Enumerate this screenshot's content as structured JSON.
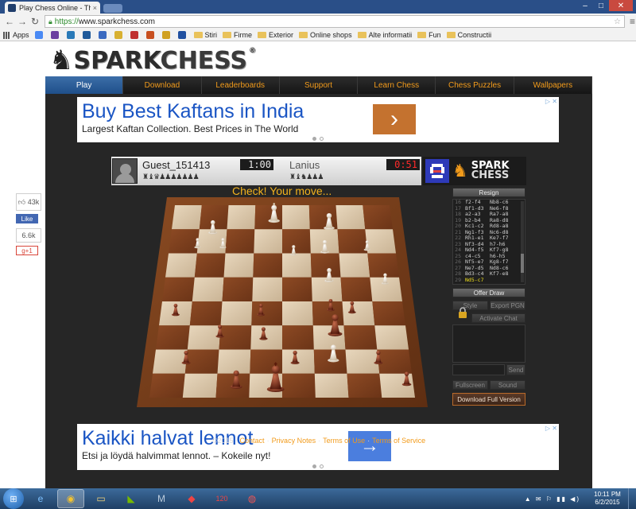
{
  "browser": {
    "tab_title": "Play Chess Online - The P",
    "tab_close": "×",
    "url_scheme": "https://",
    "url_host": "www.sparkchess.com",
    "back_icon": "←",
    "forward_icon": "→",
    "reload_icon": "↻",
    "window_min": "–",
    "window_max": "□",
    "window_close": "✕",
    "bookmarks": [
      {
        "label": "Apps",
        "type": "apps"
      },
      {
        "label": "",
        "type": "icon",
        "color": "#4a8af4"
      },
      {
        "label": "",
        "type": "icon",
        "color": "#6b3fa0"
      },
      {
        "label": "",
        "type": "icon",
        "color": "#2a7ab8"
      },
      {
        "label": "",
        "type": "icon",
        "color": "#1f5a9a"
      },
      {
        "label": "",
        "type": "icon",
        "color": "#3a6ac0"
      },
      {
        "label": "",
        "type": "icon",
        "color": "#d8b030"
      },
      {
        "label": "",
        "type": "icon",
        "color": "#c03030"
      },
      {
        "label": "",
        "type": "icon",
        "color": "#c85020"
      },
      {
        "label": "",
        "type": "icon",
        "color": "#d0a020"
      },
      {
        "label": "",
        "type": "icon",
        "color": "#2050a0"
      },
      {
        "label": "Stiri",
        "type": "folder"
      },
      {
        "label": "Firme",
        "type": "folder"
      },
      {
        "label": "Exterior",
        "type": "folder"
      },
      {
        "label": "Online shops",
        "type": "folder"
      },
      {
        "label": "Alte informatii",
        "type": "folder"
      },
      {
        "label": "Fun",
        "type": "folder"
      },
      {
        "label": "Constructii",
        "type": "folder"
      }
    ]
  },
  "site": {
    "logo_text_1": "SPARK",
    "logo_text_2": "CHESS",
    "logo_reg": "®",
    "nav": [
      "Play",
      "Download",
      "Leaderboards",
      "Support",
      "Learn Chess",
      "Chess Puzzles",
      "Wallpapers"
    ],
    "active_nav": "Play"
  },
  "ads": {
    "top": {
      "title": "Buy Best Kaftans in India",
      "text": "Largest Kaftan Collection. Best Prices in The World",
      "arrow": "›",
      "adchoice": "▷ ✕"
    },
    "bottom": {
      "title": "Kaikki halvat lennot",
      "text": "Etsi ja löydä halvimmat lennot. – Kokeile nyt!",
      "arrow": "→",
      "adchoice": "▷ ✕"
    }
  },
  "game": {
    "player_name": "Guest_151413",
    "player_captured": "♜♝♛♟♟♟♟♟♟♟",
    "player_clock": "1:00",
    "opponent_name": "Lanius",
    "opponent_captured": "♜♝♞♟♟♟",
    "opponent_clock": "0:51",
    "status": "Check! Your move...",
    "engine_logo_1": "SPARK",
    "engine_logo_2": "CHESS"
  },
  "panel": {
    "resign": "Resign",
    "offer_draw": "Offer Draw",
    "style": "Style",
    "export_pgn": "Export PGN",
    "activate_chat": "Activate Chat",
    "send": "Send",
    "fullscreen": "Fullscreen",
    "sound": "Sound",
    "download": "Download Full Version",
    "moves": [
      {
        "n": "16",
        "w": "f2-f4",
        "b": "Nb8-c6"
      },
      {
        "n": "17",
        "w": "Bf1-d3",
        "b": "Ne6-f8"
      },
      {
        "n": "18",
        "w": "a2-a3",
        "b": "Ra7-a8"
      },
      {
        "n": "19",
        "w": "b2-b4",
        "b": "Ra8-d8"
      },
      {
        "n": "20",
        "w": "Kc1-c2",
        "b": "Rd8-a8"
      },
      {
        "n": "21",
        "w": "Ng1-f3",
        "b": "Nc6-d8"
      },
      {
        "n": "22",
        "w": "Rh1-e1",
        "b": "Ke7-f7"
      },
      {
        "n": "23",
        "w": "Nf3-d4",
        "b": "h7-h6"
      },
      {
        "n": "24",
        "w": "Nd4-f5",
        "b": "Kf7-g8"
      },
      {
        "n": "25",
        "w": "c4-c5",
        "b": "h6-h5"
      },
      {
        "n": "26",
        "w": "Nf5-e7",
        "b": "Kg8-f7"
      },
      {
        "n": "27",
        "w": "Ne7-d5",
        "b": "Nd8-c6"
      },
      {
        "n": "28",
        "w": "Bd3-c4",
        "b": "Kf7-e8"
      },
      {
        "n": "29",
        "w": "Nd5-c7",
        "b": ""
      }
    ]
  },
  "social": {
    "likes": "43k",
    "fb_like": "Like",
    "shares": "6.6k",
    "gplus": "g+1"
  },
  "footer": {
    "copyright": "©2015 ·",
    "links": [
      "Contact",
      "Privacy Notes",
      "Terms of Use",
      "Terms of Service"
    ]
  },
  "taskbar": {
    "time": "10:11 PM",
    "date": "6/2/2015",
    "tray_icons": "▲ ✉ ⚐ ▮▮ ◀)"
  },
  "colors": {
    "nav_accent": "#f29b1b",
    "nav_active": "#2a5a96",
    "status_text": "#f2b21e",
    "clock_red": "#ff2a2a",
    "ad_title": "#1a55c4",
    "ad_top_arrow": "#c4722f",
    "ad_bottom_arrow": "#4b7ede"
  }
}
